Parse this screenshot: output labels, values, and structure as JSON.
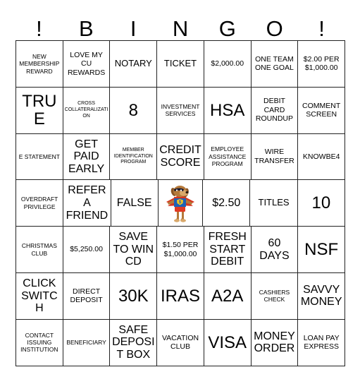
{
  "card": {
    "header_letters": [
      "!",
      "B",
      "I",
      "N",
      "G",
      "O",
      "!"
    ],
    "rows": [
      [
        {
          "text": "NEW MEMBERSHIP REWARD",
          "size": "sz-s"
        },
        {
          "text": "LOVE MY CU REWARDS",
          "size": "sz-m"
        },
        {
          "text": "NOTARY",
          "size": "sz-l"
        },
        {
          "text": "TICKET",
          "size": "sz-l"
        },
        {
          "text": "$2,000.00",
          "size": "sz-m"
        },
        {
          "text": "ONE TEAM ONE GOAL",
          "size": "sz-m"
        },
        {
          "text": "$2.00 PER $1,000.00",
          "size": "sz-m"
        }
      ],
      [
        {
          "text": "TRUE",
          "size": "sz-h"
        },
        {
          "text": "CROSS COLLATERALIZATION",
          "size": "sz-xs"
        },
        {
          "text": "8",
          "size": "sz-h"
        },
        {
          "text": "INVESTMENT SERVICES",
          "size": "sz-s"
        },
        {
          "text": "HSA",
          "size": "sz-h"
        },
        {
          "text": "DEBIT CARD ROUNDUP",
          "size": "sz-m"
        },
        {
          "text": "COMMENT SCREEN",
          "size": "sz-m"
        }
      ],
      [
        {
          "text": "E STATEMENT",
          "size": "sz-s"
        },
        {
          "text": "GET PAID EARLY",
          "size": "sz-xl"
        },
        {
          "text": "MEMBER IDENTIFICATION PROGRAM",
          "size": "sz-xs"
        },
        {
          "text": "CREDIT SCORE",
          "size": "sz-xl"
        },
        {
          "text": "EMPLOYEE ASSISTANCE PROGRAM",
          "size": "sz-s"
        },
        {
          "text": "WIRE TRANSFER",
          "size": "sz-m"
        },
        {
          "text": "KNOWBE4",
          "size": "sz-m"
        }
      ],
      [
        {
          "text": "OVERDRAFT PRIVILEGE",
          "size": "sz-s"
        },
        {
          "text": "REFER A FRIEND",
          "size": "sz-xl"
        },
        {
          "text": "FALSE",
          "size": "sz-xl"
        },
        {
          "text": "",
          "size": "sz-m",
          "icon": "superhero-dog-mascot"
        },
        {
          "text": "$2.50",
          "size": "sz-xl"
        },
        {
          "text": "TITLES",
          "size": "sz-l"
        },
        {
          "text": "10",
          "size": "sz-h"
        }
      ],
      [
        {
          "text": "CHRISTMAS CLUB",
          "size": "sz-s"
        },
        {
          "text": "$5,250.00",
          "size": "sz-m"
        },
        {
          "text": "SAVE TO WIN CD",
          "size": "sz-xl"
        },
        {
          "text": "$1.50 PER $1,000.00",
          "size": "sz-m"
        },
        {
          "text": "FRESH START DEBIT",
          "size": "sz-xl"
        },
        {
          "text": "60 DAYS",
          "size": "sz-xl"
        },
        {
          "text": "NSF",
          "size": "sz-h"
        }
      ],
      [
        {
          "text": "CLICK SWITCH",
          "size": "sz-xl"
        },
        {
          "text": "DIRECT DEPOSIT",
          "size": "sz-m"
        },
        {
          "text": "30K",
          "size": "sz-h"
        },
        {
          "text": "IRAS",
          "size": "sz-h"
        },
        {
          "text": "A2A",
          "size": "sz-h"
        },
        {
          "text": "CASHIERS CHECK",
          "size": "sz-s"
        },
        {
          "text": "SAVVY MONEY",
          "size": "sz-xl"
        }
      ],
      [
        {
          "text": "CONTACT ISSUING INSTITUTION",
          "size": "sz-s"
        },
        {
          "text": "BENEFICIARY",
          "size": "sz-s"
        },
        {
          "text": "SAFE DEPOSIT BOX",
          "size": "sz-xl"
        },
        {
          "text": "VACATION CLUB",
          "size": "sz-m"
        },
        {
          "text": "VISA",
          "size": "sz-h"
        },
        {
          "text": "MONEY ORDER",
          "size": "sz-xl"
        },
        {
          "text": "LOAN PAY EXPRESS",
          "size": "sz-m"
        }
      ]
    ],
    "free_space": {
      "icon": "superhero-dog-mascot",
      "colors": {
        "cape": "#d6361f",
        "shirt": "#1d62b5",
        "emblem": "#f2c521",
        "shorts": "#e03a24",
        "fur": "#b5793a",
        "fur_dark": "#8b5524",
        "muzzle": "#d9a86a"
      }
    },
    "grid_line_color": "#222222",
    "background_color": "#ffffff",
    "text_color": "#000000"
  }
}
